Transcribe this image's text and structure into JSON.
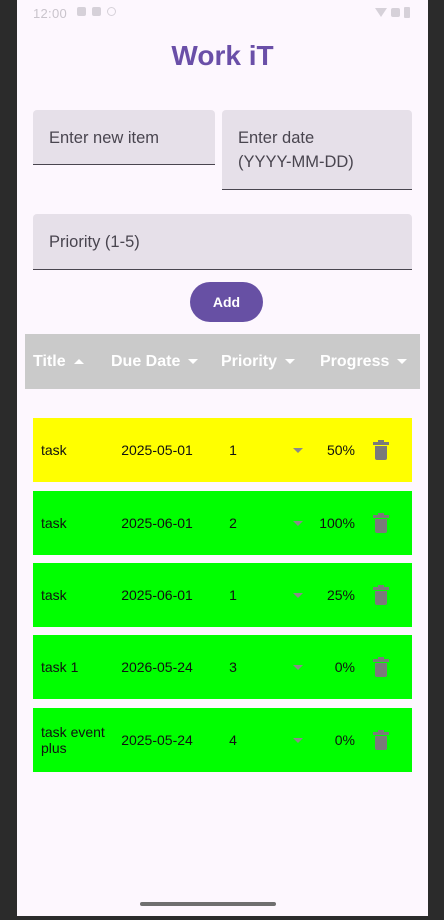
{
  "status_bar": {
    "time": "12:00",
    "icons": [
      "notification-icon",
      "settings-icon",
      "wifi-icon",
      "signal-icon",
      "battery-icon"
    ]
  },
  "app": {
    "title": "Work iT",
    "title_color": "#6a4fa8"
  },
  "form": {
    "item_placeholder": "Enter new item",
    "date_placeholder": "Enter date\n(YYYY-MM-DD)",
    "priority_placeholder": "Priority (1-5)",
    "add_label": "Add"
  },
  "table": {
    "headers": [
      {
        "label": "Title",
        "sort": "asc"
      },
      {
        "label": "Due Date",
        "sort": "desc"
      },
      {
        "label": "Priority",
        "sort": "desc"
      },
      {
        "label": "Progress",
        "sort": "desc"
      }
    ],
    "rows": [
      {
        "title": "task",
        "due": "2025-05-01",
        "priority": "1",
        "progress": "50%",
        "color": "#ffff00"
      },
      {
        "title": "task",
        "due": "2025-06-01",
        "priority": "2",
        "progress": "100%",
        "color": "#00ff00"
      },
      {
        "title": "task",
        "due": "2025-06-01",
        "priority": "1",
        "progress": "25%",
        "color": "#00ff00"
      },
      {
        "title": "task 1",
        "due": "2026-05-24",
        "priority": "3",
        "progress": "0%",
        "color": "#00ff00"
      },
      {
        "title": "task event plus",
        "due": "2025-05-24",
        "priority": "4",
        "progress": "0%",
        "color": "#00ff00"
      }
    ]
  },
  "colors": {
    "accent": "#6750a4",
    "header_bg": "#cacaca",
    "background": "#fdf7fe"
  }
}
